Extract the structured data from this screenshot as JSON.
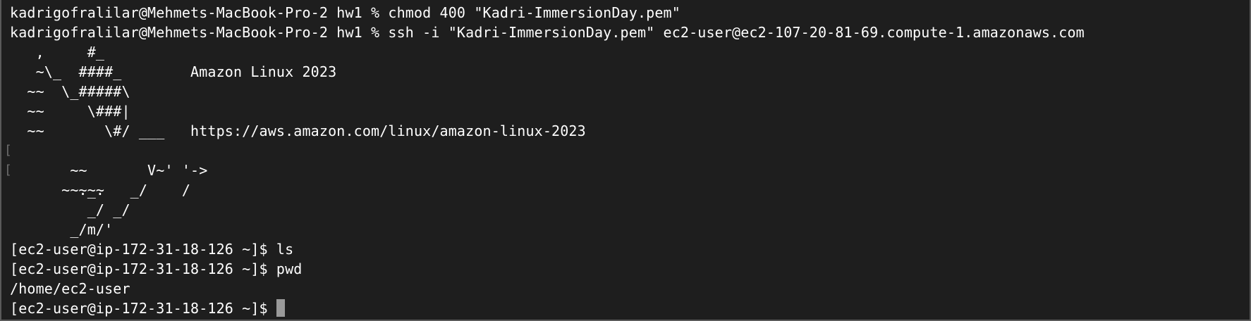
{
  "terminal": {
    "lines": [
      "kadrigofralilar@Mehmets-MacBook-Pro-2 hw1 % chmod 400 \"Kadri-ImmersionDay.pem\"",
      "kadrigofralilar@Mehmets-MacBook-Pro-2 hw1 % ssh -i \"Kadri-ImmersionDay.pem\" ec2-user@ec2-107-20-81-69.compute-1.amazonaws.com",
      "   ,     #_",
      "   ~\\_  ####_        Amazon Linux 2023",
      "  ~~  \\_#####\\",
      "  ~~     \\###|",
      "  ~~       \\#/ ___   https://aws.amazon.com/linux/amazon-linux-2023",
      "   ~~       V~' '->",
      "    ~~~         /",
      "      ~~._.   _/",
      "         _/ _/",
      "       _/m/'",
      "[ec2-user@ip-172-31-18-126 ~]$ ls",
      "[ec2-user@ip-172-31-18-126 ~]$ pwd",
      "/home/ec2-user",
      "[ec2-user@ip-172-31-18-126 ~]$ "
    ],
    "side_marker": "["
  }
}
